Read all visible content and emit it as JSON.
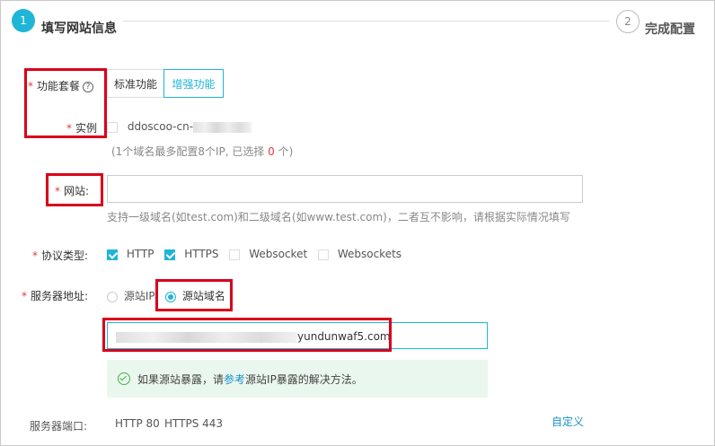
{
  "steps": [
    {
      "number": "1",
      "title": "填写网站信息"
    },
    {
      "number": "2",
      "title": "完成配置"
    }
  ],
  "form": {
    "package": {
      "label": "功能套餐",
      "options": [
        "标准功能",
        "增强功能"
      ],
      "selected": "增强功能"
    },
    "instance": {
      "label": "实例",
      "item": "ddoscoo-cn-",
      "note_prefix": "(1个域名最多配置8个IP, 已选择 ",
      "note_count": "0",
      "note_suffix": " 个)"
    },
    "website": {
      "label": "网站:",
      "value": "",
      "hint": "支持一级域名(如test.com)和二级域名(如www.test.com)，二者互不影响，请根据实际情况填写"
    },
    "protocol": {
      "label": "协议类型:",
      "options": [
        {
          "label": "HTTP",
          "checked": true
        },
        {
          "label": "HTTPS",
          "checked": true
        },
        {
          "label": "Websocket",
          "checked": false
        },
        {
          "label": "Websockets",
          "checked": false
        }
      ]
    },
    "server_address": {
      "label": "服务器地址:",
      "options": [
        "源站IP",
        "源站域名"
      ],
      "selected": "源站域名",
      "domain_value": "yundunwaf5.com"
    },
    "alert": {
      "prefix": "如果源站暴露，请",
      "link": "参考",
      "suffix": "源站IP暴露的解决方法。"
    },
    "server_port": {
      "label": "服务器端口:",
      "http": "HTTP 80",
      "https": "HTTPS 443",
      "custom_link": "自定义"
    }
  },
  "colors": {
    "accent": "#1fb5d7",
    "required": "#e4393c",
    "highlight_box": "#d9001b",
    "alert_bg": "#eaf7ee"
  }
}
